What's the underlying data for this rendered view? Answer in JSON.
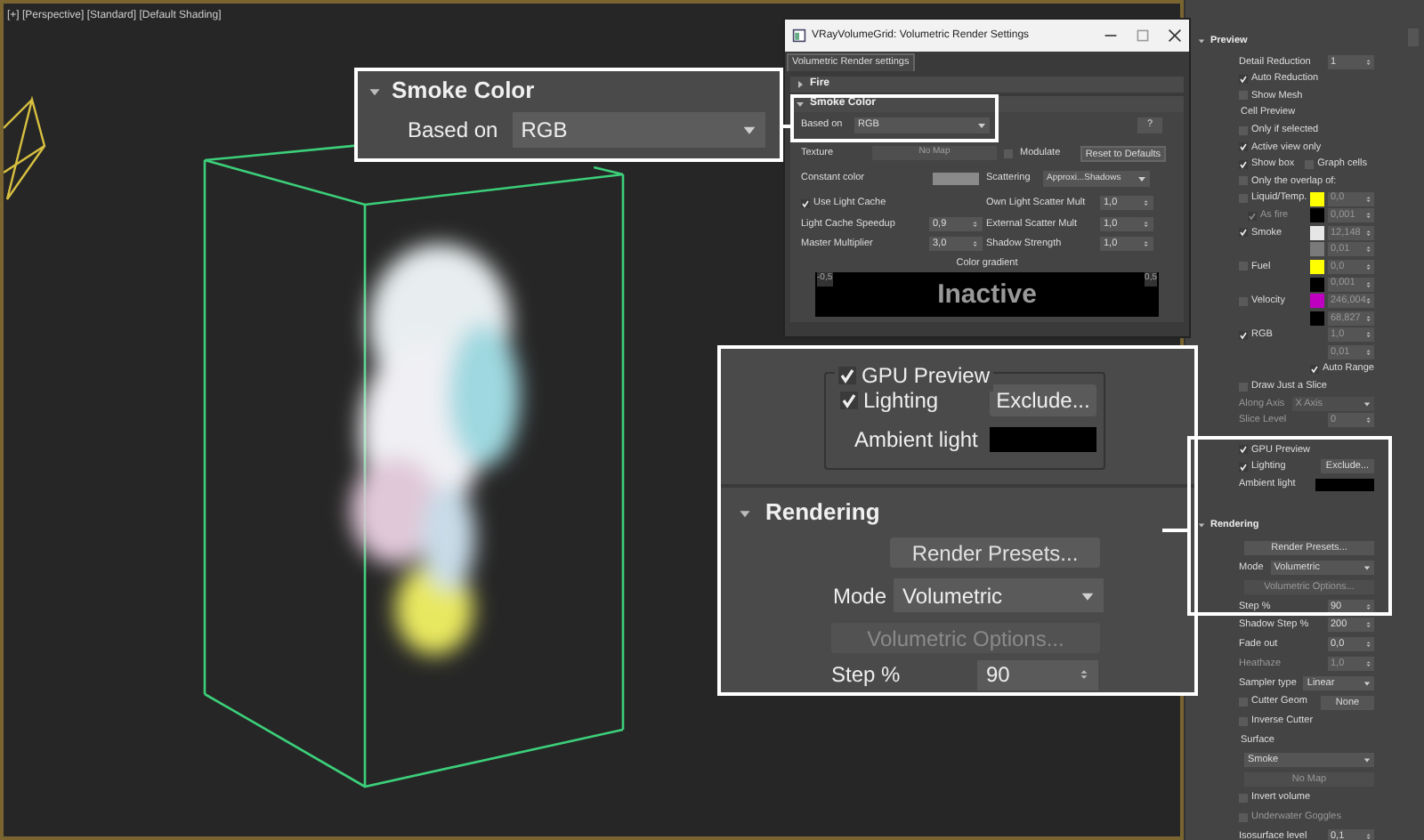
{
  "viewport": {
    "label": "[+] [Perspective] [Standard] [Default Shading]"
  },
  "dialog": {
    "title": "VRayVolumeGrid: Volumetric Render Settings",
    "tab": "Volumetric Render settings",
    "sections": [
      {
        "title": "Fire",
        "expanded": false
      },
      {
        "title": "Smoke Color",
        "expanded": true
      }
    ],
    "smoke_color": {
      "based_on_label": "Based on",
      "based_on": "RGB",
      "help": "?",
      "texture_label": "Texture",
      "texture_map": "No Map",
      "modulate": {
        "label": "Modulate",
        "checked": false
      },
      "reset": "Reset to Defaults",
      "constant_color": {
        "label": "Constant color",
        "color": "#8a8a8a"
      },
      "scattering_label": "Scattering",
      "scattering": "Approxi...Shadows",
      "use_light_cache": {
        "label": "Use Light Cache",
        "checked": true
      },
      "params": [
        {
          "label": "Light Cache Speedup",
          "value": "0,9"
        },
        {
          "label": "Master Multiplier",
          "value": "3,0"
        }
      ],
      "params_right": [
        {
          "label": "Own Light Scatter Mult",
          "value": "1,0"
        },
        {
          "label": "External Scatter Mult",
          "value": "1,0"
        },
        {
          "label": "Shadow Strength",
          "value": "1,0"
        }
      ],
      "gradient": {
        "title": "Color gradient",
        "min": "-0,5",
        "max": "0,5",
        "status": "Inactive"
      }
    }
  },
  "callouts": {
    "smoke_color": {
      "title": "Smoke Color",
      "expanded": true,
      "based_on_label": "Based on",
      "based_on": "RGB"
    },
    "gpu_rendering": {
      "gpu_preview": {
        "label": "GPU Preview",
        "checked": true
      },
      "lighting": {
        "label": "Lighting",
        "checked": true
      },
      "exclude": "Exclude...",
      "ambient": {
        "label": "Ambient light",
        "color": "#000000"
      },
      "rendering_title": "Rendering",
      "rendering_expanded": true,
      "render_presets": "Render Presets...",
      "mode_label": "Mode",
      "mode": "Volumetric",
      "volumetric_options": {
        "label": "Volumetric Options...",
        "disabled": true
      },
      "step_label": "Step %",
      "step": "90"
    }
  },
  "command_panel": {
    "sections": [
      {
        "title": "Preview",
        "expanded": true,
        "rows": [
          {
            "kind": "spinner",
            "label": "Detail Reduction",
            "value": "1",
            "disabled": false
          },
          {
            "kind": "checkbox",
            "label": "Auto Reduction",
            "checked": true,
            "disabled": false
          },
          {
            "kind": "checkbox",
            "label": "Show Mesh",
            "checked": false,
            "disabled": false
          },
          {
            "kind": "group",
            "label": "Cell Preview"
          },
          {
            "kind": "checkbox",
            "label": "Only if selected",
            "checked": false,
            "disabled": false
          },
          {
            "kind": "checkbox",
            "label": "Active view only",
            "checked": true,
            "disabled": false
          },
          {
            "kind": "checkbox_pair",
            "items": [
              {
                "label": "Show box",
                "checked": true
              },
              {
                "label": "Graph cells",
                "checked": false
              }
            ]
          },
          {
            "kind": "checkbox",
            "label": "Only the overlap of:",
            "checked": false,
            "disabled": false
          },
          {
            "kind": "channel",
            "label": "Liquid/Temp.",
            "checked": false,
            "color": "#ffff00",
            "value": "0,0",
            "sub": {
              "label": "As fire",
              "checked": true,
              "color": "#000000",
              "value": "0,001"
            }
          },
          {
            "kind": "channel",
            "label": "Smoke",
            "checked": true,
            "color": "#e6e6e6",
            "value": "12,148",
            "sub": {
              "color": "#7a7a7a",
              "value": "0,01"
            }
          },
          {
            "kind": "channel",
            "label": "Fuel",
            "checked": false,
            "color": "#ffff00",
            "value": "0,0",
            "sub": {
              "color": "#000000",
              "value": "0,001"
            }
          },
          {
            "kind": "channel",
            "label": "Velocity",
            "checked": false,
            "color": "#c000c0",
            "value": "246,004",
            "sub": {
              "color": "#000000",
              "value": "68,827"
            }
          },
          {
            "kind": "channel",
            "label": "RGB",
            "checked": true,
            "value": "1,0",
            "sub": {
              "value": "0,01"
            }
          },
          {
            "kind": "checkbox_end",
            "label": "Auto Range",
            "checked": true,
            "disabled": false
          },
          {
            "kind": "checkbox",
            "label": "Draw Just a Slice",
            "checked": false,
            "disabled": false
          },
          {
            "kind": "dropdown",
            "label": "Along Axis",
            "value": "X Axis",
            "disabled": true
          },
          {
            "kind": "spinner",
            "label": "Slice Level",
            "value": "0",
            "disabled": true
          },
          {
            "kind": "group_checkbox",
            "label": "GPU Preview",
            "checked": true,
            "disabled": false
          },
          {
            "kind": "checkbox_button",
            "label": "Lighting",
            "checked": true,
            "button": "Exclude..."
          },
          {
            "kind": "color",
            "label": "Ambient light",
            "color": "#000000"
          }
        ]
      },
      {
        "title": "Rendering",
        "expanded": true,
        "rows": [
          {
            "kind": "button",
            "label": "Render Presets...",
            "disabled": false
          },
          {
            "kind": "dropdown",
            "label": "Mode",
            "value": "Volumetric",
            "disabled": false
          },
          {
            "kind": "button",
            "label": "Volumetric Options...",
            "disabled": true
          },
          {
            "kind": "spinner",
            "label": "Step %",
            "value": "90",
            "disabled": false
          },
          {
            "kind": "spinner",
            "label": "Shadow Step %",
            "value": "200",
            "disabled": false
          },
          {
            "kind": "spinner",
            "label": "Fade out",
            "value": "0,0",
            "disabled": false
          },
          {
            "kind": "spinner",
            "label": "Heathaze",
            "value": "1,0",
            "disabled": true
          },
          {
            "kind": "dropdown",
            "label": "Sampler type",
            "value": "Linear",
            "disabled": false
          },
          {
            "kind": "checkbox_button",
            "label": "Cutter Geom",
            "checked": false,
            "button": "None"
          },
          {
            "kind": "checkbox",
            "label": "Inverse Cutter",
            "checked": false,
            "disabled": false
          },
          {
            "kind": "group",
            "label": "Surface"
          },
          {
            "kind": "dropdown",
            "value": "Smoke",
            "disabled": false
          },
          {
            "kind": "button",
            "label": "No Map",
            "disabled": true
          },
          {
            "kind": "checkbox",
            "label": "Invert volume",
            "checked": false,
            "disabled": false
          },
          {
            "kind": "checkbox",
            "label": "Underwater Goggles",
            "checked": false,
            "disabled": true
          },
          {
            "kind": "spinner",
            "label": "Isosurface level",
            "value": "0,1",
            "disabled": false
          }
        ]
      }
    ]
  }
}
